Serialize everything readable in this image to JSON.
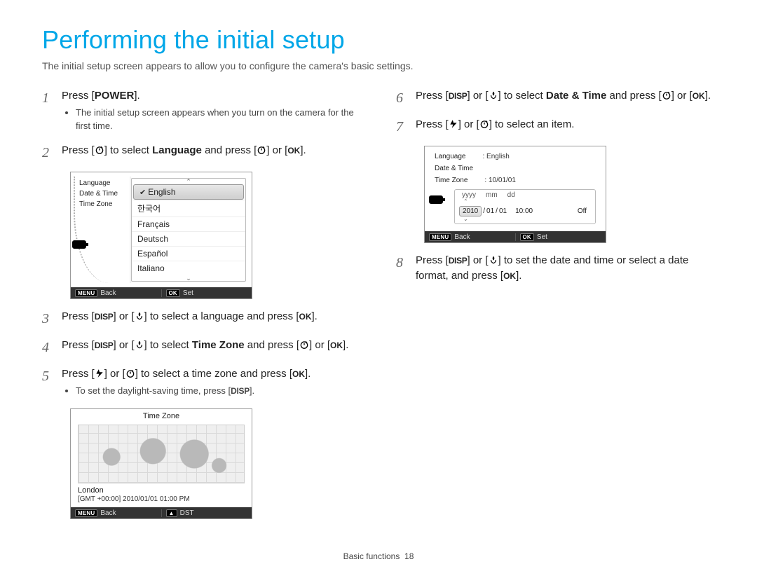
{
  "title_part1": "Performing",
  "title_part2": "the initial setup",
  "intro": "The initial setup screen appears to allow you to configure the camera's basic settings.",
  "icons": {
    "disp": "DISP",
    "ok": "OK",
    "menu": "MENU",
    "up_triangle": "▲"
  },
  "steps": {
    "s1": {
      "num": "1",
      "pre": "Press [",
      "btn": "POWER",
      "post": "].",
      "bullet": "The initial setup screen appears when you turn on the camera for the first time."
    },
    "s2": {
      "num": "2",
      "a": "Press [",
      "b": "] to select ",
      "strong": "Language",
      "c": " and press [",
      "d": "] or [",
      "e": "]."
    },
    "s3": {
      "num": "3",
      "a": "Press [",
      "b": "] or [",
      "c": "] to select a language and press [",
      "d": "]."
    },
    "s4": {
      "num": "4",
      "a": "Press [",
      "b": "] or [",
      "c": "] to select ",
      "strong": "Time Zone",
      "d": " and press [",
      "e": "] or [",
      "f": "]."
    },
    "s5": {
      "num": "5",
      "a": "Press [",
      "b": "] or [",
      "c": "] to select a time zone and press [",
      "d": "].",
      "bullet_a": "To set the daylight-saving time, press [",
      "bullet_b": "]."
    },
    "s6": {
      "num": "6",
      "a": "Press [",
      "b": "] or [",
      "c": "] to select ",
      "strong": "Date & Time",
      "d": " and press [",
      "e": "] or [",
      "f": "]."
    },
    "s7": {
      "num": "7",
      "a": "Press [",
      "b": "] or [",
      "c": "] to select an item."
    },
    "s8": {
      "num": "8",
      "a": "Press [",
      "b": "] or [",
      "c": "] to set the date and time or select a date format, and press [",
      "d": "]."
    }
  },
  "screen_lang": {
    "left": {
      "language": "Language",
      "date_time": "Date & Time",
      "time_zone": "Time Zone"
    },
    "options": [
      "English",
      "한국어",
      "Français",
      "Deutsch",
      "Español",
      "Italiano"
    ],
    "selected_index": 0,
    "footer": {
      "back": "Back",
      "set": "Set"
    }
  },
  "screen_tz": {
    "title": "Time Zone",
    "city": "London",
    "gmt": "[GMT +00:00] 2010/01/01 01:00 PM",
    "footer": {
      "back": "Back",
      "dst": "DST"
    }
  },
  "screen_dt": {
    "rows": {
      "language_k": "Language",
      "language_v": ": English",
      "date_time_k": "Date & Time",
      "time_zone_k": "Time Zone",
      "time_zone_v": ": 10/01/01"
    },
    "edit": {
      "lbl_y": "yyyy",
      "lbl_m": "mm",
      "lbl_d": "dd",
      "year": "2010",
      "sep1": "/",
      "mon": "01",
      "sep2": "/",
      "day": "01",
      "time": "10:00",
      "off": "Off"
    },
    "footer": {
      "back": "Back",
      "set": "Set"
    }
  },
  "footer": {
    "section": "Basic functions",
    "page": "18"
  }
}
